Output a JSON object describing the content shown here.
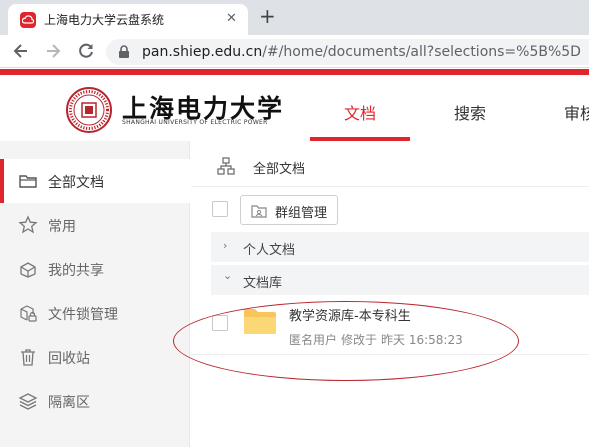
{
  "browser": {
    "tab_title": "上海电力大学云盘系统",
    "tab_close": "✕",
    "new_tab": "+",
    "url_host": "pan.shiep.edu.cn",
    "url_path": "/#/home/documents/all?selections=%5B%5D"
  },
  "header": {
    "brand_cn": "上海电力大学",
    "brand_en": "SHANGHAI UNIVERSITY OF ELECTRIC POWER",
    "nav": [
      {
        "label": "文档",
        "active": true
      },
      {
        "label": "搜索",
        "active": false
      },
      {
        "label": "审核",
        "active": false
      }
    ],
    "accent_color": "#e0262d"
  },
  "sidebar": {
    "items": [
      {
        "label": "全部文档",
        "icon": "folder-icon",
        "active": true
      },
      {
        "label": "常用",
        "icon": "star-icon",
        "active": false
      },
      {
        "label": "我的共享",
        "icon": "share-box-icon",
        "active": false
      },
      {
        "label": "文件锁管理",
        "icon": "lock-cube-icon",
        "active": false
      },
      {
        "label": "回收站",
        "icon": "trash-icon",
        "active": false
      },
      {
        "label": "隔离区",
        "icon": "layers-icon",
        "active": false
      }
    ]
  },
  "main": {
    "breadcrumb": "全部文档",
    "group_manage_label": "群组管理",
    "sections": [
      {
        "label": "个人文档",
        "chevron": "›",
        "expanded": false
      },
      {
        "label": "文档库",
        "chevron": "⌄",
        "expanded": true
      }
    ],
    "file": {
      "name": "教学资源库-本专科生",
      "owner": "匿名用户",
      "modified_label": "修改于",
      "modified_time": "昨天 16:58:23"
    }
  }
}
